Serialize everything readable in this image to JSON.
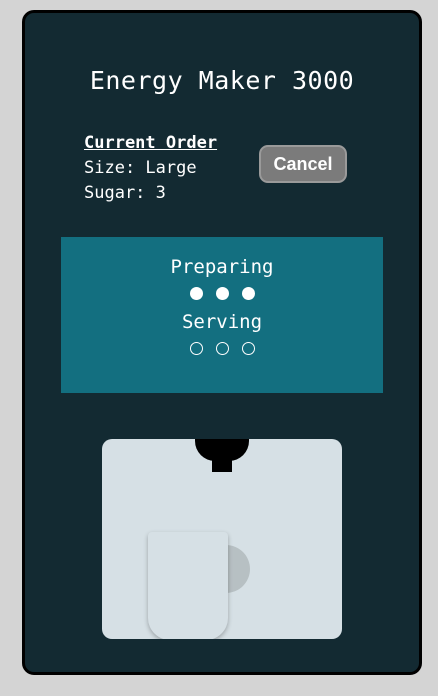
{
  "app": {
    "title": "Energy Maker 3000"
  },
  "order": {
    "heading": "Current Order",
    "size_line": "Size: Large",
    "sugar_line": "Sugar: 3"
  },
  "cancel_label": "Cancel",
  "status": {
    "stages": [
      {
        "label": "Preparing",
        "dots": [
          true,
          true,
          true
        ]
      },
      {
        "label": "Serving",
        "dots": [
          false,
          false,
          false
        ]
      }
    ]
  },
  "colors": {
    "page_background": "#d4d4d4",
    "machine_body": "#132a32",
    "status_panel": "#136f80",
    "cancel_button": "#7b7b7b",
    "dispenser": "#d6e0e5"
  },
  "icons": {
    "nozzle": "nozzle-icon",
    "mug": "mug-icon"
  }
}
